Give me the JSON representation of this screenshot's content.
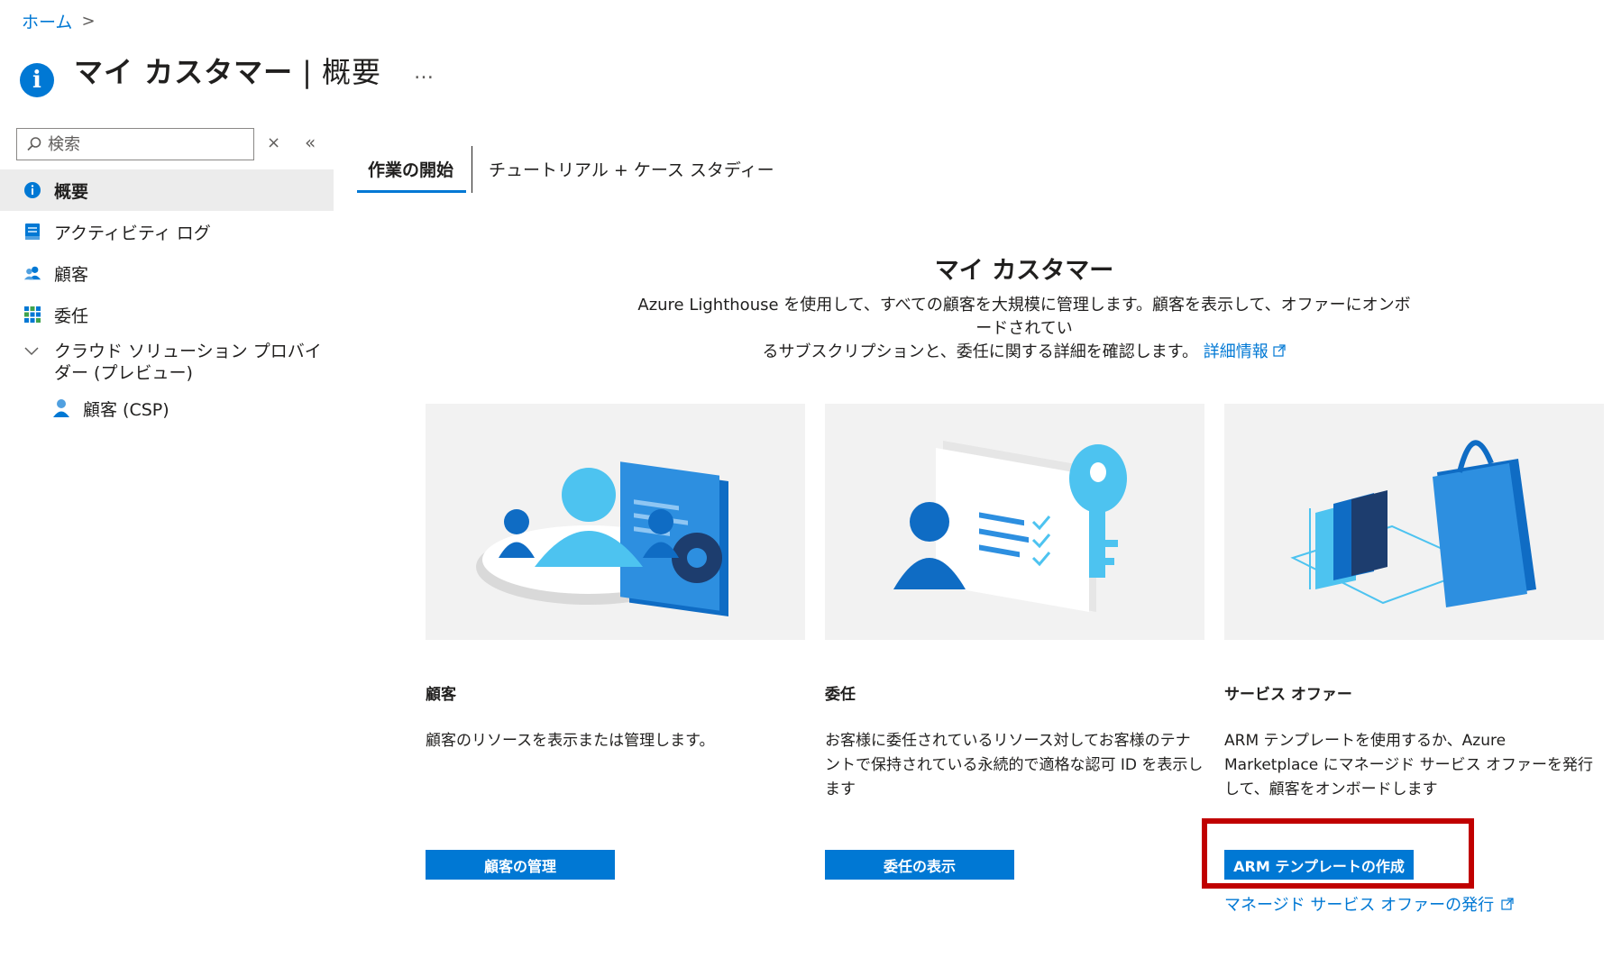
{
  "breadcrumb": {
    "home": "ホーム",
    "chevron": ">"
  },
  "header": {
    "title": "マイ カスタマー",
    "separator": "|",
    "subtitle": "概要",
    "more": "…"
  },
  "sidebar": {
    "search_placeholder": "検索",
    "clear": "×",
    "collapse": "«",
    "items": [
      {
        "label": "概要",
        "icon": "info-icon"
      },
      {
        "label": "アクティビティ ログ",
        "icon": "log-icon"
      },
      {
        "label": "顧客",
        "icon": "people-icon"
      },
      {
        "label": "委任",
        "icon": "grid-icon"
      },
      {
        "label": "クラウド ソリューション プロバイダー (プレビュー)",
        "icon": "chevron-down-icon"
      },
      {
        "label": "顧客 (CSP)",
        "icon": "person-icon"
      }
    ]
  },
  "tabs": [
    {
      "label": "作業の開始"
    },
    {
      "label": "チュートリアル + ケース スタディー"
    }
  ],
  "hero": {
    "title": "マイ カスタマー",
    "desc_line1": "Azure Lighthouse を使用して、すべての顧客を大規模に管理します。顧客を表示して、オファーにオンボードされてい",
    "desc_line2": "るサブスクリプションと、委任に関する詳細を確認します。",
    "learn_more": "詳細情報"
  },
  "cards": [
    {
      "heading": "顧客",
      "text": "顧客のリソースを表示または管理します。",
      "button": "顧客の管理"
    },
    {
      "heading": "委任",
      "text": "お客様に委任されているリソース対してお客様のテナントで保持されている永続的で適格な認可 ID を表示します",
      "button": "委任の表示"
    },
    {
      "heading": "サービス オファー",
      "text": "ARM テンプレートを使用するか、Azure Marketplace にマネージド サービス オファーを発行して、顧客をオンボードします",
      "button": "ARM テンプレートの作成",
      "link": "マネージド サービス オファーの発行"
    }
  ],
  "colors": {
    "accent": "#0078d4",
    "highlight": "#c00000",
    "active_bg": "#ececec",
    "card_bg": "#f2f2f2"
  }
}
